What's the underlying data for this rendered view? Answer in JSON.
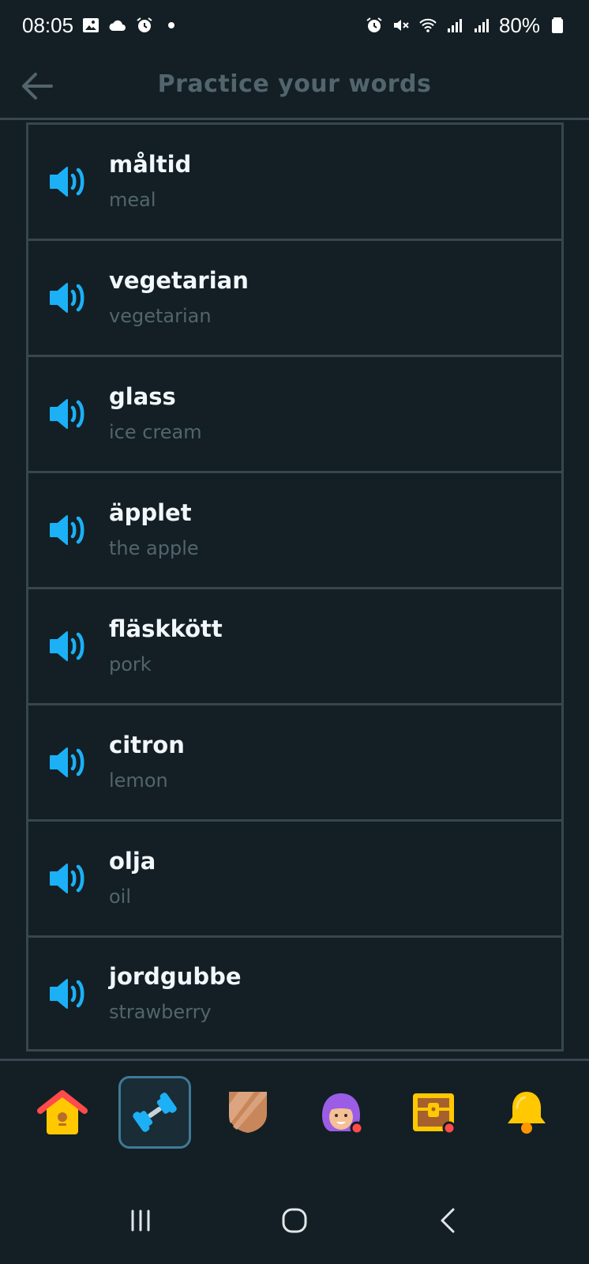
{
  "status_bar": {
    "time": "08:05",
    "battery": "80%",
    "left_icons": [
      "gallery-icon",
      "cloud-icon",
      "alarm-icon",
      "dot-icon"
    ],
    "right_icons": [
      "alarm-icon",
      "mute-icon",
      "wifi-icon",
      "signal-icon",
      "signal-icon",
      "battery-icon"
    ]
  },
  "header": {
    "title": "Practice your words"
  },
  "words": [
    {
      "word": "måltid",
      "translation": "meal"
    },
    {
      "word": "vegetarian",
      "translation": "vegetarian"
    },
    {
      "word": "glass",
      "translation": "ice cream"
    },
    {
      "word": "äpplet",
      "translation": "the apple"
    },
    {
      "word": "fläskkött",
      "translation": "pork"
    },
    {
      "word": "citron",
      "translation": "lemon"
    },
    {
      "word": "olja",
      "translation": "oil"
    },
    {
      "word": "jordgubbe",
      "translation": "strawberry"
    }
  ],
  "bottom_nav": {
    "items": [
      "home-icon",
      "practice-dumbbell-icon",
      "league-shield-icon",
      "profile-avatar-icon",
      "treasure-chest-icon",
      "notifications-bell-icon"
    ],
    "active_index": 1
  },
  "colors": {
    "background": "#131f24",
    "border": "#37464f",
    "title": "#52656d",
    "speaker": "#1cb0f6",
    "word": "#f1f7fb",
    "translation": "#52656d"
  }
}
